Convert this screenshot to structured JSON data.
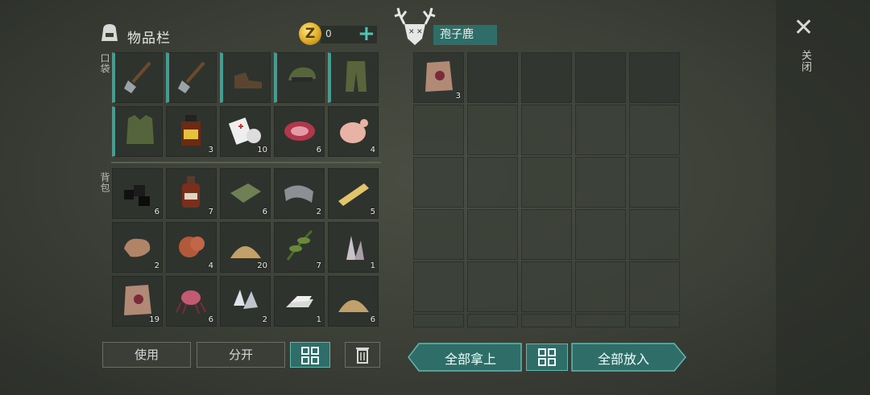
{
  "inventory": {
    "title": "物品栏",
    "coins": "0",
    "pocket_label": "口袋",
    "backpack_label": "背包"
  },
  "pocket_slots": [
    {
      "name": "shovel-icon",
      "count": ""
    },
    {
      "name": "shovel-icon",
      "count": ""
    },
    {
      "name": "boots-icon",
      "count": ""
    },
    {
      "name": "camo-cap-icon",
      "count": ""
    },
    {
      "name": "camo-pants-icon",
      "count": ""
    },
    {
      "name": "camo-vest-icon",
      "count": ""
    },
    {
      "name": "medicine-bottle-icon",
      "count": "3"
    },
    {
      "name": "bandage-icon",
      "count": "10"
    },
    {
      "name": "raw-meat-icon",
      "count": "6"
    },
    {
      "name": "raw-chicken-icon",
      "count": "4"
    }
  ],
  "backpack_slots": [
    {
      "name": "coal-icon",
      "count": "6"
    },
    {
      "name": "bottle-icon",
      "count": "7"
    },
    {
      "name": "cloth-icon",
      "count": "6"
    },
    {
      "name": "leather-icon",
      "count": "2"
    },
    {
      "name": "wood-plank-icon",
      "count": "5"
    },
    {
      "name": "stone-icon",
      "count": "2"
    },
    {
      "name": "copper-ore-icon",
      "count": "4"
    },
    {
      "name": "sand-pile-icon",
      "count": "20"
    },
    {
      "name": "herb-icon",
      "count": "7"
    },
    {
      "name": "crystal-icon",
      "count": "1"
    },
    {
      "name": "hide-icon",
      "count": "19"
    },
    {
      "name": "spore-icon",
      "count": "6"
    },
    {
      "name": "quartz-icon",
      "count": "2"
    },
    {
      "name": "iron-ingot-icon",
      "count": "1"
    },
    {
      "name": "sand-pile-icon",
      "count": "6"
    }
  ],
  "loot": {
    "title": "孢子鹿",
    "items": [
      {
        "name": "hide-icon",
        "count": "3"
      }
    ]
  },
  "buttons": {
    "use": "使用",
    "split": "分开",
    "take_all": "全部拿上",
    "put_all": "全部放入"
  },
  "close_label": "关闭",
  "colors": {
    "accent": "#3f9f93",
    "button_teal": "#2f6e68",
    "coin": "#d9a521"
  }
}
